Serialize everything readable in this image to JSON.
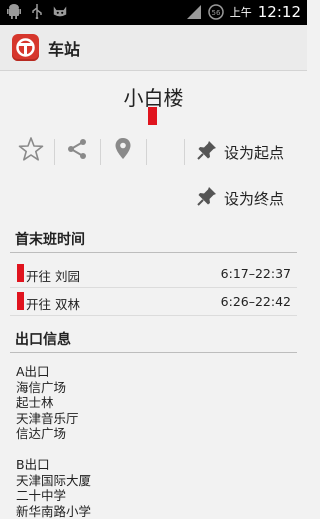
{
  "status_bar": {
    "ampm": "上午",
    "time": "12:12",
    "icons": [
      "android-icon",
      "usb-icon",
      "cat-icon",
      "signal-icon",
      "battery-icon"
    ],
    "battery_label": "56"
  },
  "action_bar": {
    "title": "车站",
    "icon": "metro-logo-icon",
    "brand_color": "#d6362c"
  },
  "station": {
    "name": "小白楼",
    "line_color": "#e0141e"
  },
  "toolbar": {
    "icons": [
      "star-icon",
      "share-icon",
      "location-icon"
    ],
    "set_start_label": "设为起点",
    "set_end_label": "设为终点"
  },
  "schedule": {
    "header": "首末班时间",
    "rows": [
      {
        "direction": "开往 刘园",
        "time": "6:17–22:37"
      },
      {
        "direction": "开往 双林",
        "time": "6:26–22:42"
      }
    ]
  },
  "exits": {
    "header": "出口信息",
    "groups": [
      {
        "name": "A出口",
        "places": [
          "海信广场",
          "起士林",
          "天津音乐厅",
          "信达广场"
        ]
      },
      {
        "name": "B出口",
        "places": [
          "天津国际大厦",
          "二十中学",
          "新华南路小学"
        ]
      }
    ]
  }
}
